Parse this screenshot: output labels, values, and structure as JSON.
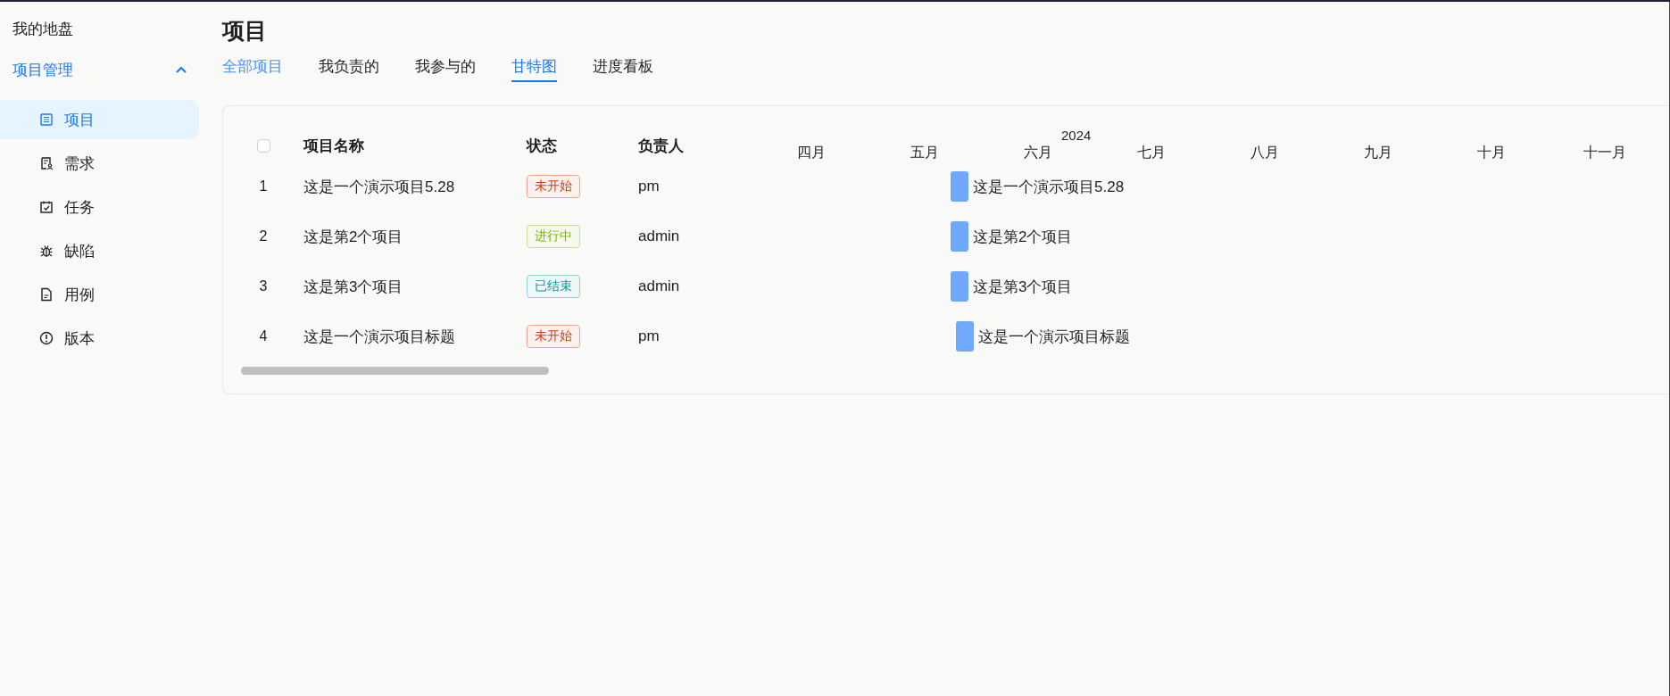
{
  "sidebar": {
    "top_item": "我的地盘",
    "group": {
      "label": "项目管理",
      "expanded": true,
      "items": [
        {
          "label": "项目",
          "selected": true
        },
        {
          "label": "需求",
          "selected": false
        },
        {
          "label": "任务",
          "selected": false
        },
        {
          "label": "缺陷",
          "selected": false
        },
        {
          "label": "用例",
          "selected": false
        },
        {
          "label": "版本",
          "selected": false
        }
      ]
    }
  },
  "page_title": "项目",
  "tabs": [
    {
      "label": "全部项目",
      "selected": false,
      "hovered": true
    },
    {
      "label": "我负责的",
      "selected": false,
      "hovered": false
    },
    {
      "label": "我参与的",
      "selected": false,
      "hovered": false
    },
    {
      "label": "甘特图",
      "selected": true,
      "hovered": false
    },
    {
      "label": "进度看板",
      "selected": false,
      "hovered": false
    }
  ],
  "table": {
    "select_all_checked": false,
    "columns": [
      "项目名称",
      "状态",
      "负责人"
    ],
    "rows": [
      {
        "index": "1",
        "name": "这是一个演示项目5.28",
        "status": "未开始",
        "color": "#d4380d",
        "owner": "pm"
      },
      {
        "index": "2",
        "name": "这是第2个项目",
        "status": "进行中",
        "color": "#7cb305",
        "owner": "admin"
      },
      {
        "index": "3",
        "name": "这是第3个项目",
        "status": "已结束",
        "color": "#08979c",
        "owner": "admin"
      },
      {
        "index": "4",
        "name": "这是一个演示项目标题",
        "status": "未开始",
        "color": "#d4380d",
        "owner": "pm"
      }
    ]
  },
  "gantt": {
    "year": "2024",
    "months": [
      "四月",
      "五月",
      "六月",
      "七月",
      "八月",
      "九月",
      "十月",
      "十一月"
    ],
    "bars": [
      {
        "label": "这是一个演示项目5.28"
      },
      {
        "label": "这是第2个项目"
      },
      {
        "label": "这是第3个项目"
      },
      {
        "label": "这是一个演示项目标题"
      }
    ]
  }
}
